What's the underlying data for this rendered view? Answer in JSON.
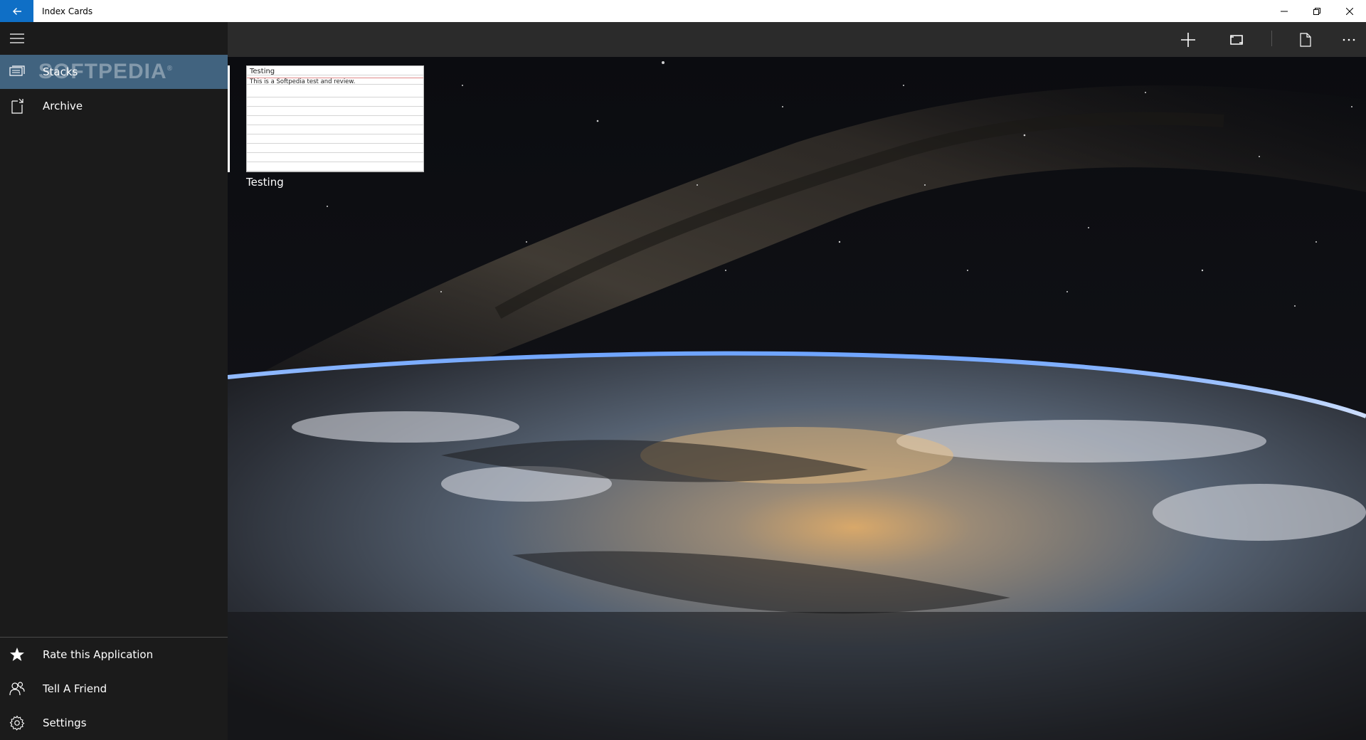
{
  "window": {
    "title": "Index Cards",
    "back_icon": "arrow-left-icon",
    "controls": [
      "minimize-icon",
      "restore-icon",
      "close-icon"
    ]
  },
  "sidebar": {
    "menu_icon": "hamburger-menu-icon",
    "watermark": "SOFTPEDIA",
    "items": [
      {
        "label": "Stacks",
        "icon": "stacks-icon",
        "active": true
      },
      {
        "label": "Archive",
        "icon": "archive-icon",
        "active": false
      }
    ],
    "footer_items": [
      {
        "label": "Rate this Application",
        "icon": "star-icon"
      },
      {
        "label": "Tell A Friend",
        "icon": "people-icon"
      },
      {
        "label": "Settings",
        "icon": "gear-icon"
      }
    ]
  },
  "command_bar": {
    "buttons": [
      "add-icon",
      "loop-icon",
      "document-icon",
      "more-icon"
    ]
  },
  "main": {
    "stacks": [
      {
        "card_title": "Testing",
        "card_body": "This is a Softpedia test and review.",
        "caption": "Testing"
      }
    ]
  },
  "colors": {
    "accent": "#0f6fc6",
    "active_nav": "#41637f",
    "sidebar_bg": "#1b1b1b",
    "command_bar_bg": "#2b2b2b"
  }
}
